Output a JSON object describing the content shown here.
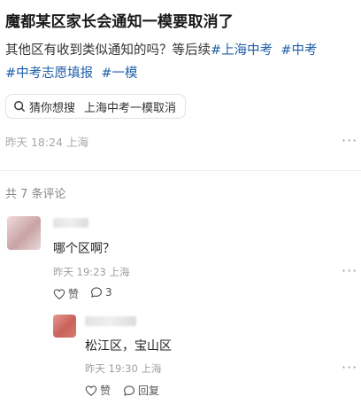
{
  "post": {
    "title": "魔都某区家长会通知一模要取消了",
    "body_line1_prefix": "其他区有收到类似通知的吗？等后续",
    "tags": [
      "#上海中考",
      "#中考",
      "#中考志愿填报",
      "#一模"
    ],
    "search_chip": {
      "label": "猜你想搜",
      "query": "上海中考一模取消"
    },
    "meta": "昨天  18:24  上海",
    "more": "···"
  },
  "comments_section": {
    "count_label": "共 7 条评论",
    "comments": [
      {
        "text": "哪个区啊？",
        "meta": "昨天  19:23  上海",
        "like_label": "赞",
        "reply_label": "3",
        "more": "···"
      }
    ],
    "replies": [
      {
        "text": "松江区，宝山区",
        "meta": "昨天  19:30  上海",
        "like_label": "赞",
        "reply_label": "回复",
        "more": "···"
      }
    ]
  }
}
